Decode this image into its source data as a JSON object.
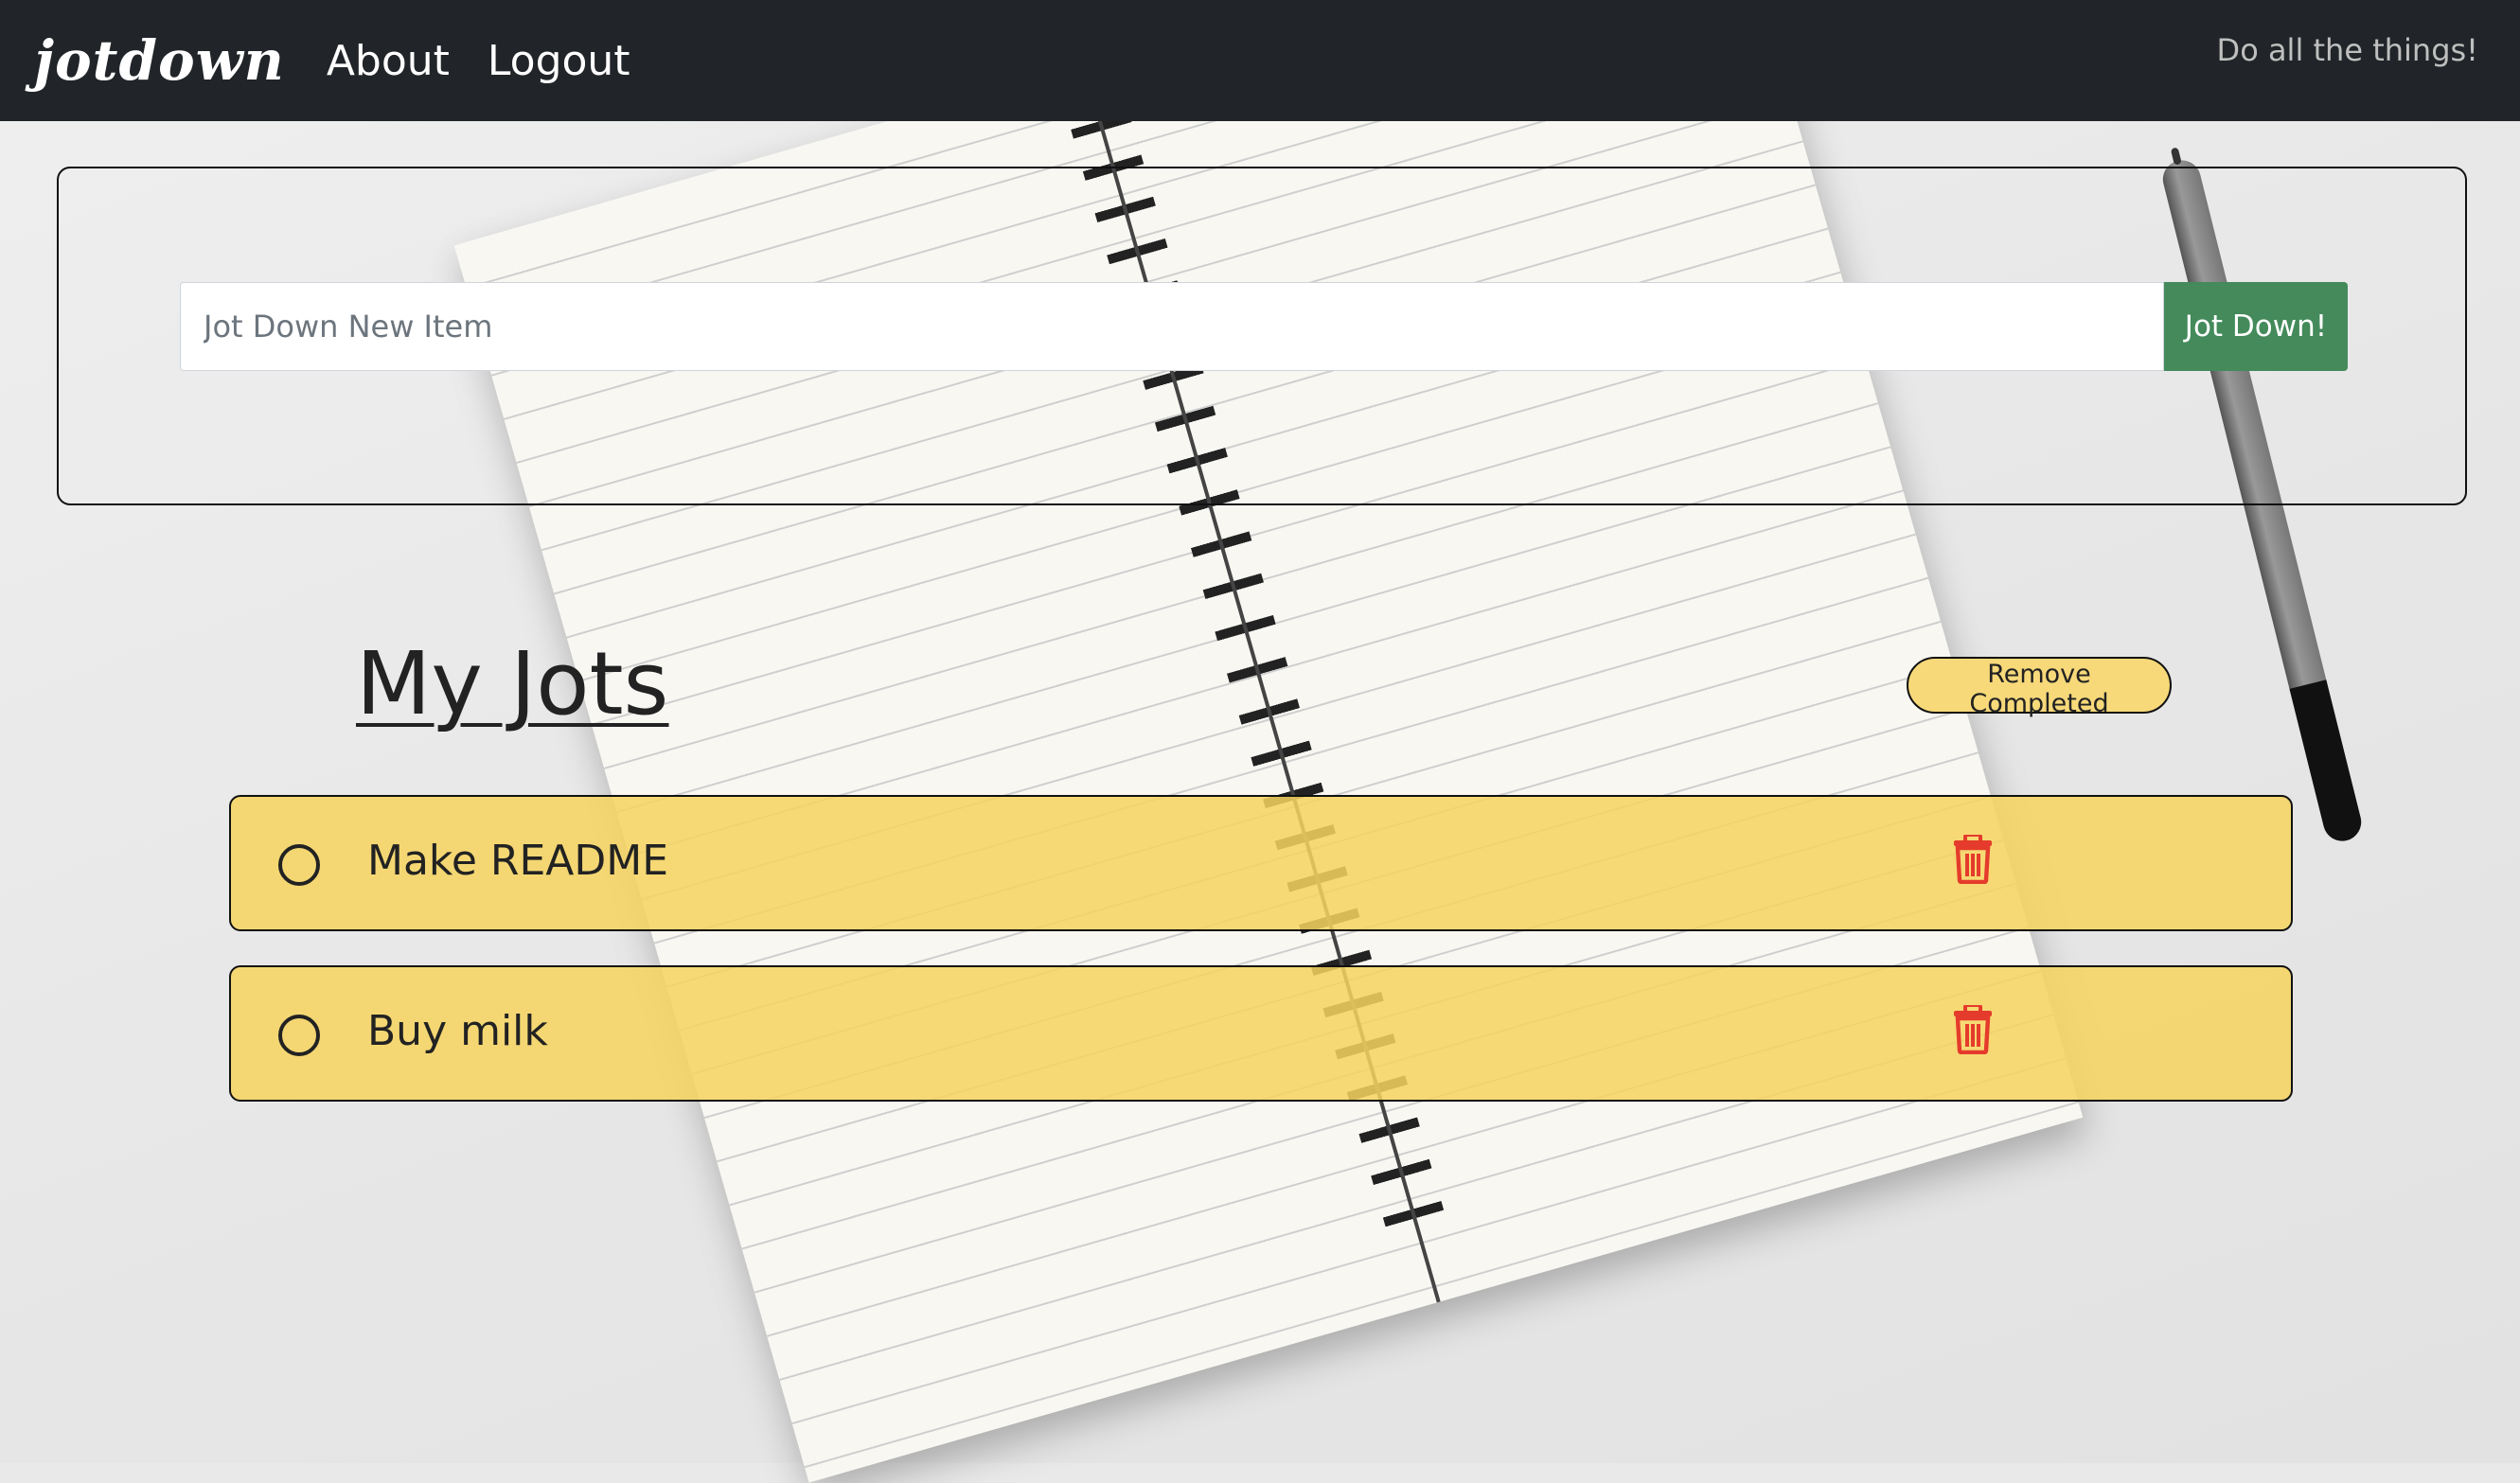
{
  "navbar": {
    "brand": "jotdown",
    "links": [
      "About",
      "Logout"
    ],
    "tagline": "Do all the things!"
  },
  "form": {
    "placeholder": "Jot Down New Item",
    "submit_label": "Jot Down!"
  },
  "jots": {
    "title": "My Jots",
    "remove_label": "Remove Completed",
    "items": [
      {
        "text": "Make README",
        "completed": false
      },
      {
        "text": "Buy milk",
        "completed": false
      }
    ]
  },
  "colors": {
    "navbar": "#212529",
    "submit": "#448a5b",
    "jot_item": "#f6d460",
    "trash": "#e53b2c"
  },
  "icons": [
    "circle-checkbox-icon",
    "trash-icon"
  ]
}
